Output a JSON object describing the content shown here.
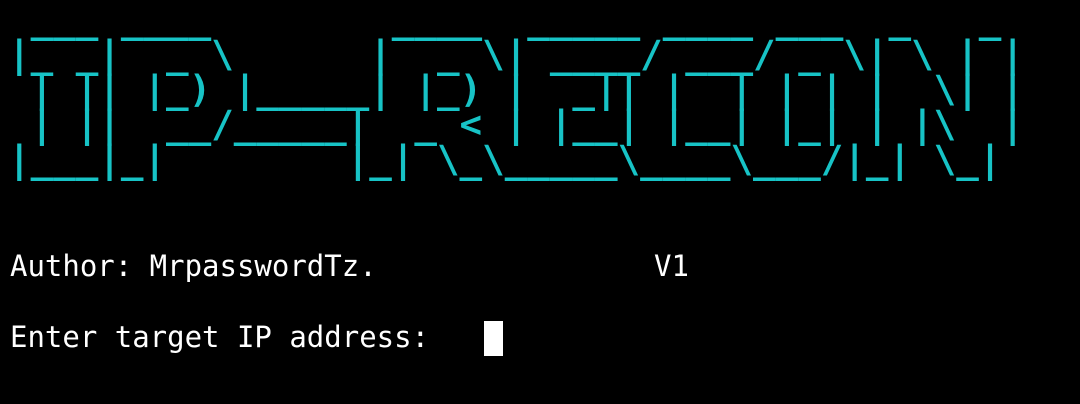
{
  "terminal": {
    "banner_lines": [
      " ___ ____        ____  _____ ____ ___  _   _ ",
      "|_ _|  _ \\      |  _ \\| ____/ ___/ _ \\| \\ | |",
      " | || |_) |_____| |_) |  _|| |  | | | |  \\| |",
      " | ||  __/_____|  _ < | |__| |__| |_| | |\\  |",
      "|___|_|        |_| \\_\\_____\\____\\___/|_| \\_|"
    ],
    "banner_color": "#17c3c6",
    "author_label": "Author: MrpasswordTz.",
    "version": "V1",
    "prompt": "Enter target IP address: ",
    "input_value": "",
    "background": "#000000",
    "text_color": "#ffffff"
  }
}
